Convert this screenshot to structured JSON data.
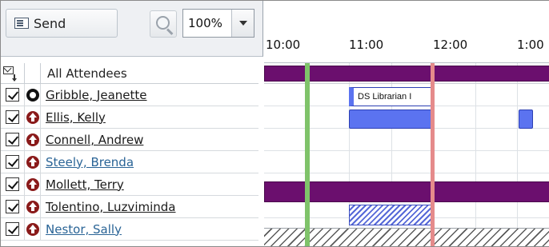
{
  "toolbar": {
    "send_label": "Send",
    "zoom_value": "100%"
  },
  "attendees": {
    "header_label": "All Attendees",
    "rows": [
      {
        "name": "Gribble, Jeanette",
        "response": "organizer",
        "checked": true
      },
      {
        "name": "Ellis, Kelly",
        "response": "required",
        "checked": true
      },
      {
        "name": "Connell, Andrew",
        "response": "required",
        "checked": true
      },
      {
        "name": "Steely, Brenda",
        "response": "required",
        "checked": true
      },
      {
        "name": "Mollett, Terry",
        "response": "required",
        "checked": true
      },
      {
        "name": "Tolentino, Luzviminda",
        "response": "required",
        "checked": true
      },
      {
        "name": "Nestor, Sally",
        "response": "required",
        "checked": true
      }
    ]
  },
  "schedule": {
    "time_labels": [
      "10:00",
      "11:00",
      "12:00",
      "1:00"
    ],
    "meeting_label": "DS Librarian I",
    "colors": {
      "busy": "#6b0f6e",
      "tentative": "#5b73f0",
      "start_line": "#7fc36a",
      "end_line": "#e58b8b"
    }
  }
}
